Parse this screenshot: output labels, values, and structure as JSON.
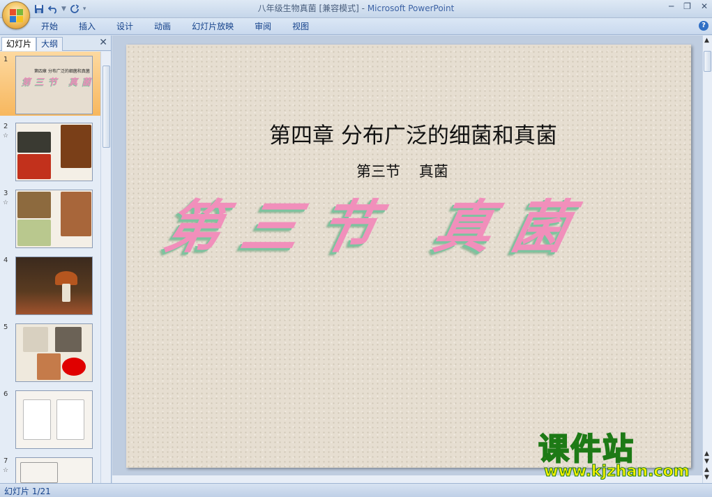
{
  "window": {
    "title_doc": "八年级生物真菌 [兼容模式] - ",
    "title_app": "Microsoft PowerPoint"
  },
  "ribbon": {
    "tabs": [
      "开始",
      "插入",
      "设计",
      "动画",
      "幻灯片放映",
      "审阅",
      "视图"
    ]
  },
  "pane": {
    "tab_slides": "幻灯片",
    "tab_outline": "大纲",
    "thumbnails": [
      {
        "num": "1",
        "selected": true
      },
      {
        "num": "2"
      },
      {
        "num": "3"
      },
      {
        "num": "4"
      },
      {
        "num": "5"
      },
      {
        "num": "6"
      },
      {
        "num": "7"
      }
    ]
  },
  "slide": {
    "title": "第四章  分布广泛的细菌和真菌",
    "subtitle": "第三节    真菌",
    "art_text": "第三节 真菌"
  },
  "thumb1": {
    "title": "第四章 分布广泛的细菌和真菌",
    "art": "第三节 真菌"
  },
  "status": {
    "slide_indicator": "幻灯片 1/21"
  },
  "watermark": {
    "brand": "课件站",
    "url": "www.kjzhan.com"
  },
  "colors": {
    "ribbon_text": "#15428b",
    "slide_bg": "#e6ded1",
    "art_pink": "#f18fbb",
    "art_shadow": "#7bc49f",
    "watermark_yellow": "#f6f200",
    "watermark_green": "#1d7a16"
  }
}
